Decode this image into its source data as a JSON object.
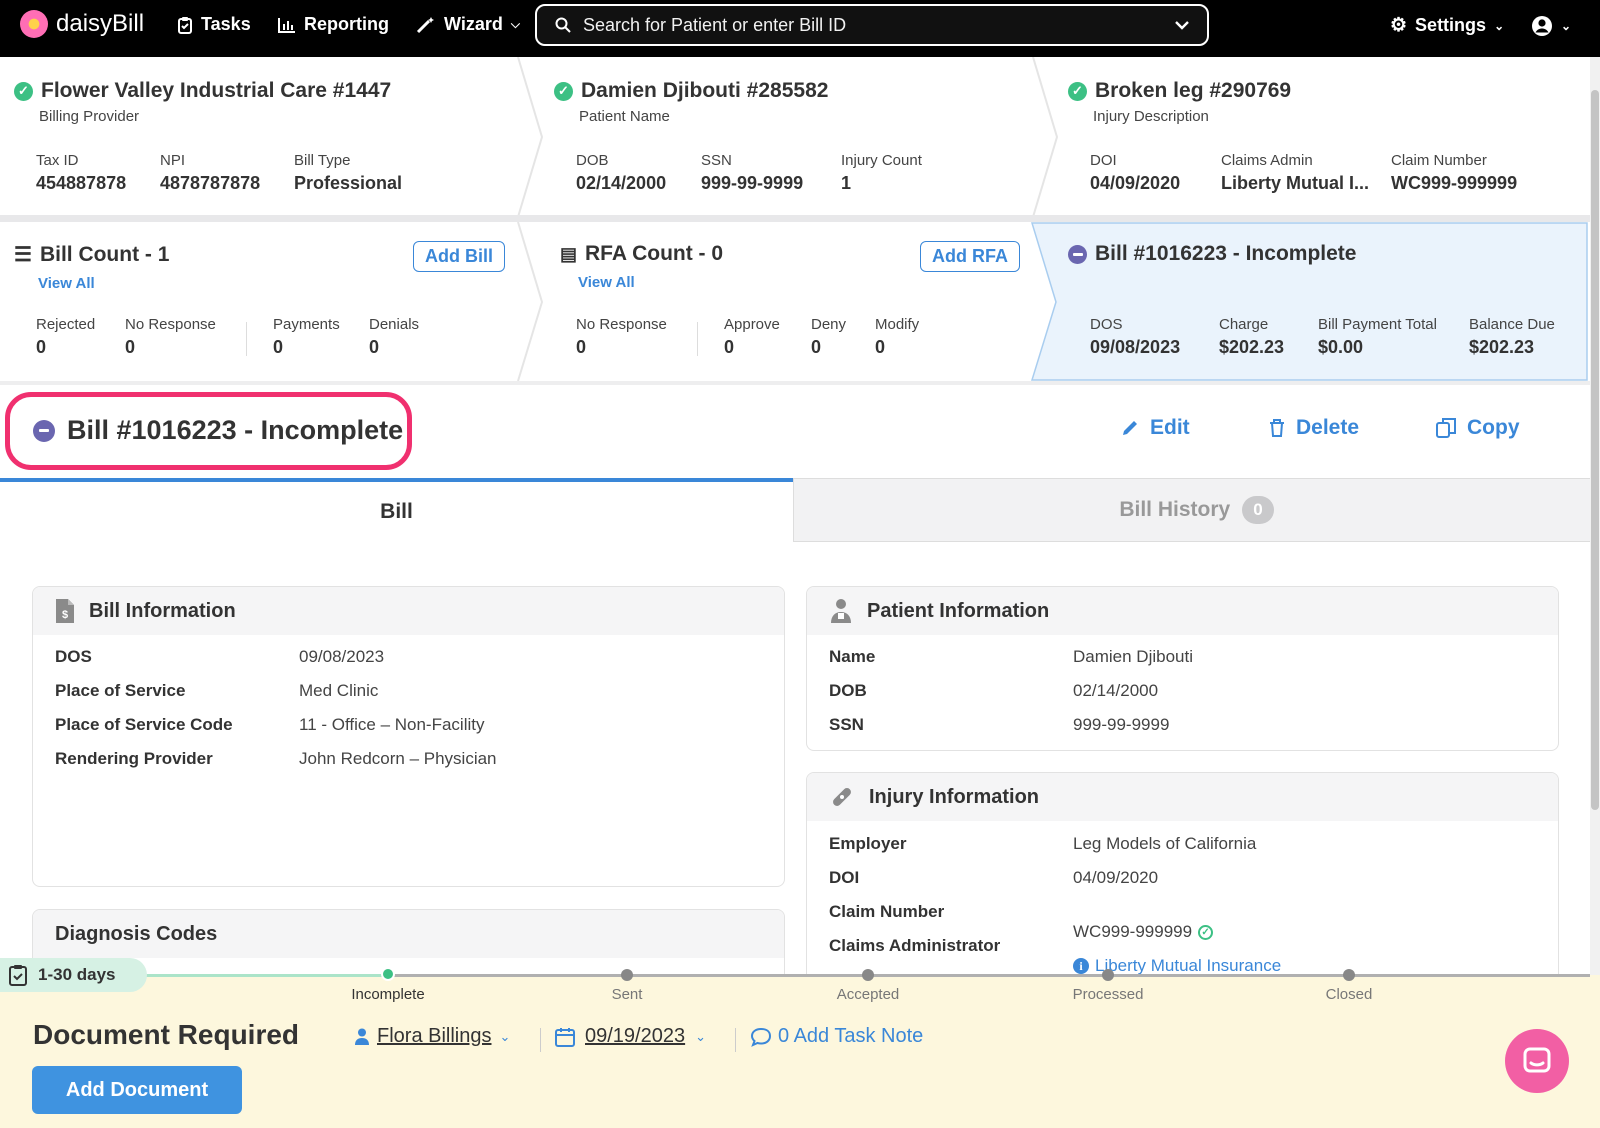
{
  "nav": {
    "brand": "daisyBill",
    "tasks": "Tasks",
    "reporting": "Reporting",
    "wizard": "Wizard",
    "search_placeholder": "Search for Patient or enter Bill ID",
    "settings": "Settings"
  },
  "summary": {
    "provider": {
      "title": "Flower Valley Industrial Care #1447",
      "sub": "Billing Provider",
      "f1l": "Tax ID",
      "f1v": "454887878",
      "f2l": "NPI",
      "f2v": "4878787878",
      "f3l": "Bill Type",
      "f3v": "Professional"
    },
    "patient": {
      "title": "Damien Djibouti #285582",
      "sub": "Patient Name",
      "f1l": "DOB",
      "f1v": "02/14/2000",
      "f2l": "SSN",
      "f2v": "999-99-9999",
      "f3l": "Injury Count",
      "f3v": "1"
    },
    "injury": {
      "title": "Broken leg #290769",
      "sub": "Injury Description",
      "f1l": "DOI",
      "f1v": "04/09/2020",
      "f2l": "Claims Admin",
      "f2v": "Liberty Mutual I...",
      "f3l": "Claim Number",
      "f3v": "WC999-999999"
    }
  },
  "counts": {
    "bills": {
      "title": "Bill Count - 1",
      "view": "View All",
      "add": "Add Bill",
      "rejected_l": "Rejected",
      "rejected_v": "0",
      "noresp_l": "No Response",
      "noresp_v": "0",
      "payments_l": "Payments",
      "payments_v": "0",
      "denials_l": "Denials",
      "denials_v": "0"
    },
    "rfa": {
      "title": "RFA Count - 0",
      "view": "View All",
      "add": "Add RFA",
      "noresp_l": "No Response",
      "noresp_v": "0",
      "approve_l": "Approve",
      "approve_v": "0",
      "deny_l": "Deny",
      "deny_v": "0",
      "modify_l": "Modify",
      "modify_v": "0"
    },
    "bill": {
      "title": "Bill #1016223 - Incomplete",
      "dos_l": "DOS",
      "dos_v": "09/08/2023",
      "charge_l": "Charge",
      "charge_v": "$202.23",
      "paytotal_l": "Bill Payment Total",
      "paytotal_v": "$0.00",
      "balance_l": "Balance Due",
      "balance_v": "$202.23"
    }
  },
  "header": {
    "title": "Bill #1016223 - Incomplete",
    "edit": "Edit",
    "delete": "Delete",
    "copy": "Copy"
  },
  "tabs": {
    "bill": "Bill",
    "history": "Bill History",
    "history_count": "0"
  },
  "bill_info": {
    "title": "Bill Information",
    "rows": [
      {
        "label": "DOS",
        "value": "09/08/2023"
      },
      {
        "label": "Place of Service",
        "value": "Med Clinic"
      },
      {
        "label": "Place of Service Code",
        "value": "11 - Office – Non-Facility"
      },
      {
        "label": "Rendering Provider",
        "value": "John Redcorn – Physician"
      }
    ]
  },
  "diagnosis": {
    "title": "Diagnosis Codes"
  },
  "patient_info": {
    "title": "Patient Information",
    "rows": [
      {
        "label": "Name",
        "value": "Damien Djibouti"
      },
      {
        "label": "DOB",
        "value": "02/14/2000"
      },
      {
        "label": "SSN",
        "value": "999-99-9999"
      }
    ]
  },
  "injury_info": {
    "title": "Injury Information",
    "rows": [
      {
        "label": "Employer",
        "value": "Leg Models of California"
      },
      {
        "label": "DOI",
        "value": "04/09/2020"
      },
      {
        "label": "Claim Number",
        "value": "WC999-999999"
      },
      {
        "label": "Claims Administrator",
        "value": "Liberty Mutual Insurance"
      }
    ]
  },
  "progress": {
    "badge": "1-30 days",
    "steps": [
      "Incomplete",
      "Sent",
      "Accepted",
      "Processed",
      "Closed"
    ],
    "current_step": "Incomplete"
  },
  "task": {
    "title": "Document Required",
    "assignee": "Flora Billings",
    "date": "09/19/2023",
    "note": "0 Add Task Note",
    "add_doc": "Add Document"
  },
  "colors": {
    "accent": "#3a87d8",
    "highlight": "#f0306f",
    "success": "#3cc084",
    "incomplete": "#6a66b0",
    "task_bg": "#fdf7dd"
  }
}
